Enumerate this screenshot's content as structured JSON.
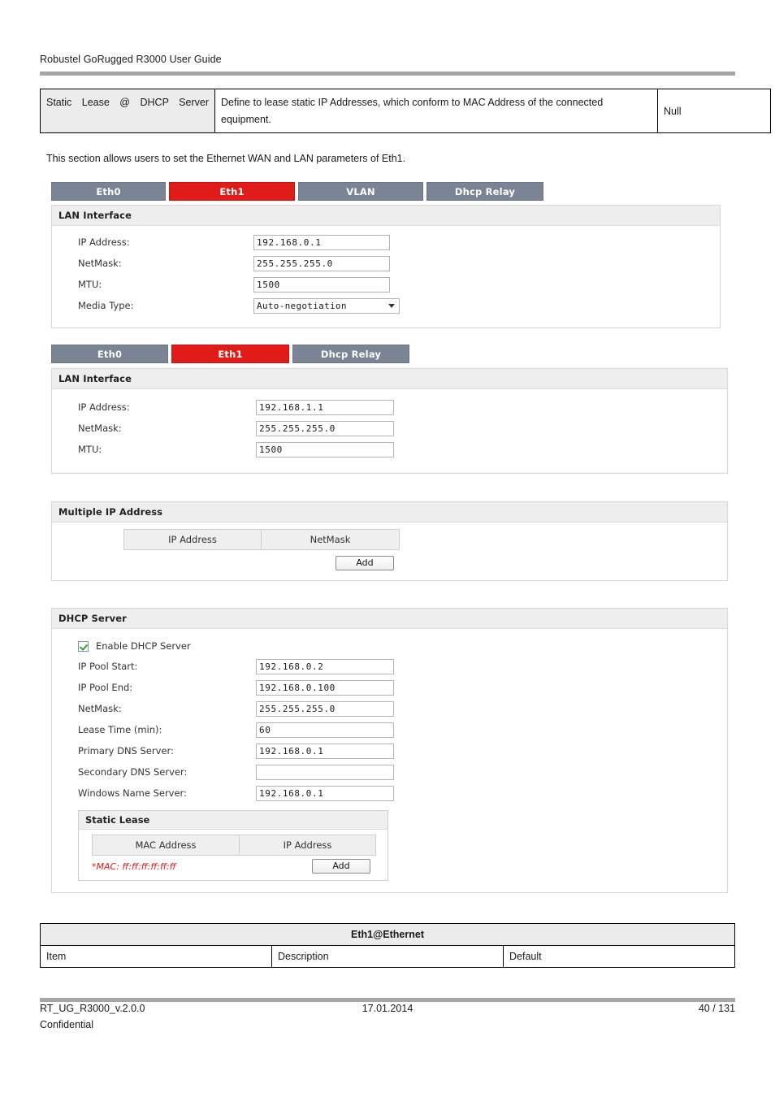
{
  "page": {
    "header_title": "Robustel GoRugged R3000 User Guide",
    "intro": "This section allows users to set the Ethernet WAN and LAN parameters of Eth1."
  },
  "top_table": {
    "item": "Static Lease @ DHCP Server",
    "description": "Define to lease static IP Addresses, which conform to MAC Address of the connected equipment.",
    "default": "Null"
  },
  "screenshot_1": {
    "tabs": [
      {
        "label": "Eth0",
        "active": false
      },
      {
        "label": "Eth1",
        "active": true
      },
      {
        "label": "VLAN",
        "active": false
      },
      {
        "label": "Dhcp Relay",
        "active": false
      }
    ],
    "panel_title": "LAN Interface",
    "fields": [
      {
        "label": "IP Address:",
        "value": "192.168.0.1",
        "type": "text"
      },
      {
        "label": "NetMask:",
        "value": "255.255.255.0",
        "type": "text"
      },
      {
        "label": "MTU:",
        "value": "1500",
        "type": "text"
      },
      {
        "label": "Media Type:",
        "value": "Auto-negotiation",
        "type": "select"
      }
    ]
  },
  "screenshot_2": {
    "tabs": [
      {
        "label": "Eth0",
        "active": false
      },
      {
        "label": "Eth1",
        "active": true
      },
      {
        "label": "Dhcp Relay",
        "active": false
      }
    ],
    "panel_title": "LAN Interface",
    "fields": [
      {
        "label": "IP Address:",
        "value": "192.168.1.1",
        "type": "text"
      },
      {
        "label": "NetMask:",
        "value": "255.255.255.0",
        "type": "text"
      },
      {
        "label": "MTU:",
        "value": "1500",
        "type": "text"
      }
    ]
  },
  "screenshot_3": {
    "panel_title": "Multiple IP Address",
    "columns": [
      "IP Address",
      "NetMask"
    ],
    "rows": [],
    "add_label": "Add"
  },
  "screenshot_4": {
    "panel_title": "DHCP Server",
    "checkbox_label": "Enable DHCP Server",
    "checkbox_checked": true,
    "fields": [
      {
        "label": "IP Pool Start:",
        "value": "192.168.0.2"
      },
      {
        "label": "IP Pool End:",
        "value": "192.168.0.100"
      },
      {
        "label": "NetMask:",
        "value": "255.255.255.0"
      },
      {
        "label": "Lease Time (min):",
        "value": "60"
      },
      {
        "label": "Primary DNS Server:",
        "value": "192.168.0.1"
      },
      {
        "label": "Secondary DNS Server:",
        "value": ""
      },
      {
        "label": "Windows Name Server:",
        "value": "192.168.0.1"
      }
    ],
    "static_lease": {
      "title": "Static Lease",
      "columns": [
        "MAC Address",
        "IP Address"
      ],
      "rows": [],
      "hint": "*MAC: ff:ff:ff:ff:ff:ff",
      "add_label": "Add"
    }
  },
  "bottom_table": {
    "title": "Eth1@Ethernet",
    "headers": [
      "Item",
      "Description",
      "Default"
    ]
  },
  "footer": {
    "left": "RT_UG_R3000_v.2.0.0",
    "center": "17.01.2014",
    "right": "40 / 131",
    "second_line": "Confidential"
  },
  "colors": {
    "tab_inactive": "#7b8494",
    "tab_active": "#e01b18",
    "rule": "#a6a6a6",
    "panel_head": "#eeeeee",
    "hint_red": "#e01b18",
    "check_green": "#2fa32f"
  }
}
